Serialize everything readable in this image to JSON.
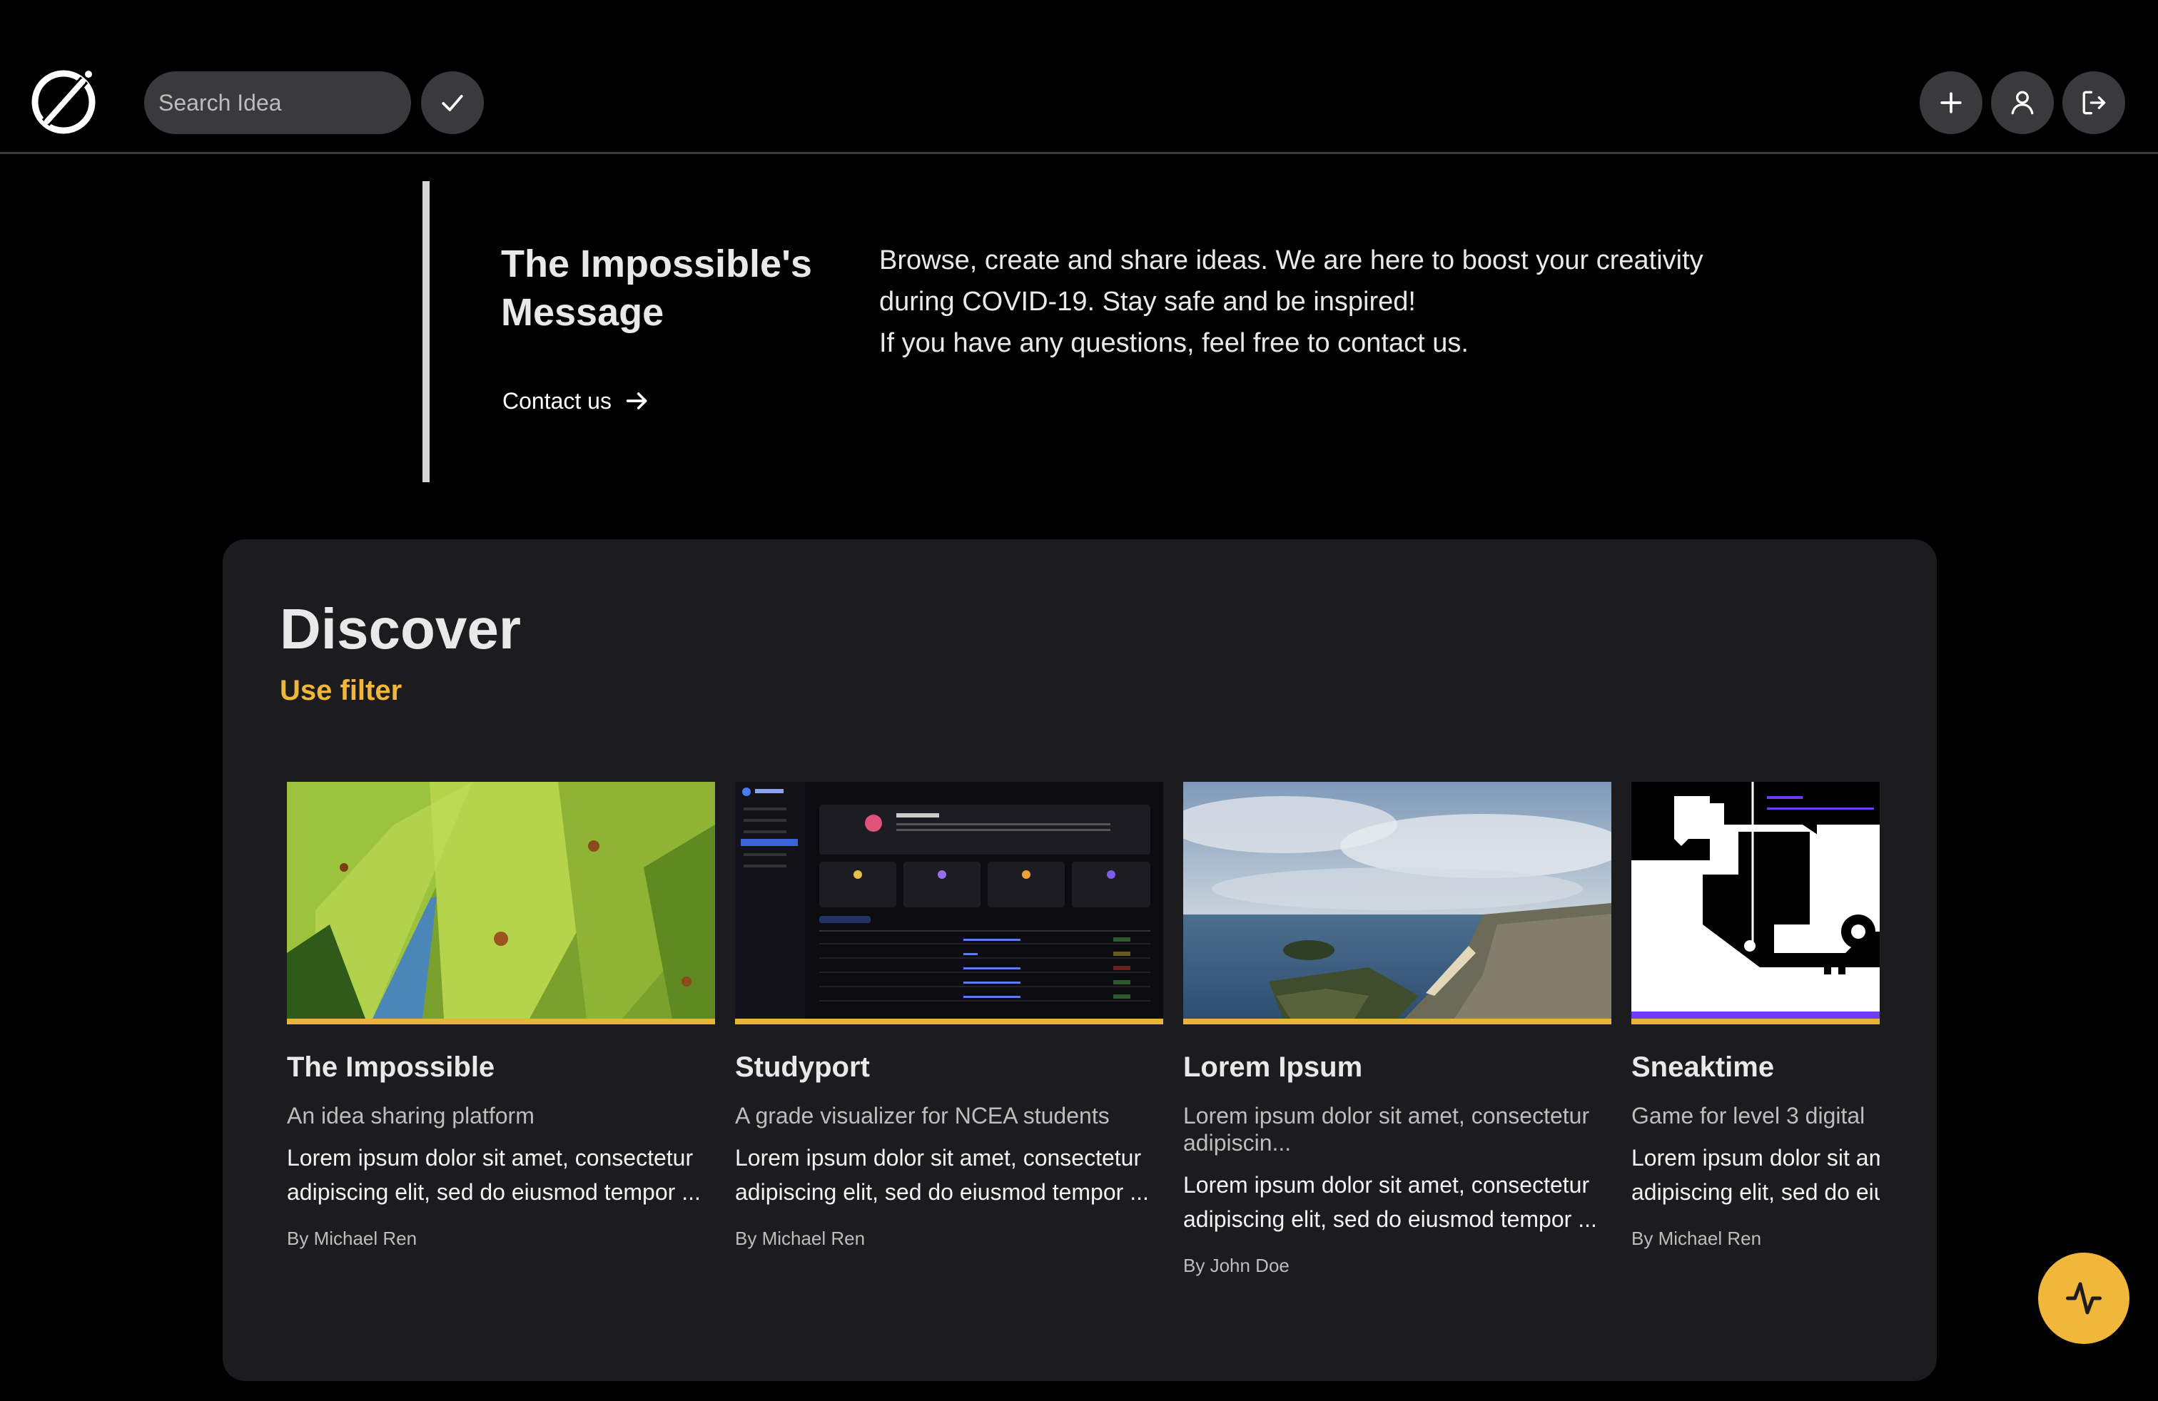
{
  "navbar": {
    "search": {
      "placeholder": "Search Idea",
      "value": ""
    },
    "icons": {
      "logo": "logo-icon",
      "confirm": "check-icon",
      "add": "plus-icon",
      "profile": "user-icon",
      "logout": "logout-icon"
    }
  },
  "message": {
    "title": "The Impossible's Message",
    "body": [
      "Browse, create and share ideas. We are here to boost your creativity during COVID-19. Stay safe and be inspired!",
      "If you have any questions, feel free to contact us."
    ],
    "contact_label": "Contact us"
  },
  "discover": {
    "title": "Discover",
    "filter_label": "Use filter",
    "cards": [
      {
        "title": "The Impossible",
        "subtitle": "An idea sharing platform",
        "description": "Lorem ipsum dolor sit amet, consectetur adipiscing elit, sed do eiusmod tempor ...",
        "author": "By Michael Ren",
        "thumbnail": "leaves-photo"
      },
      {
        "title": "Studyport",
        "subtitle": "A grade visualizer for NCEA students",
        "description": "Lorem ipsum dolor sit amet, consectetur adipiscing elit, sed do eiusmod tempor ...",
        "author": "By Michael Ren",
        "thumbnail": "dashboard-screenshot"
      },
      {
        "title": "Lorem Ipsum",
        "subtitle": "Lorem ipsum dolor sit amet, consectetur adipiscin...",
        "description": "Lorem ipsum dolor sit amet, consectetur adipiscing elit, sed do eiusmod tempor ...",
        "author": "By John Doe",
        "thumbnail": "coastline-photo"
      },
      {
        "title": "Sneaktime",
        "subtitle": "Game for level 3 digital",
        "description": "Lorem ipsum dolor sit amet, consectetur adipiscing elit, sed do eiusmod tempor ...",
        "author": "By Michael Ren",
        "thumbnail": "pixel-game-screenshot"
      }
    ]
  },
  "fab": {
    "icon": "activity-icon"
  },
  "colors": {
    "background": "#000000",
    "panel": "#1c1c1e",
    "button": "#3a3a3c",
    "accent": "#f0b73a"
  }
}
